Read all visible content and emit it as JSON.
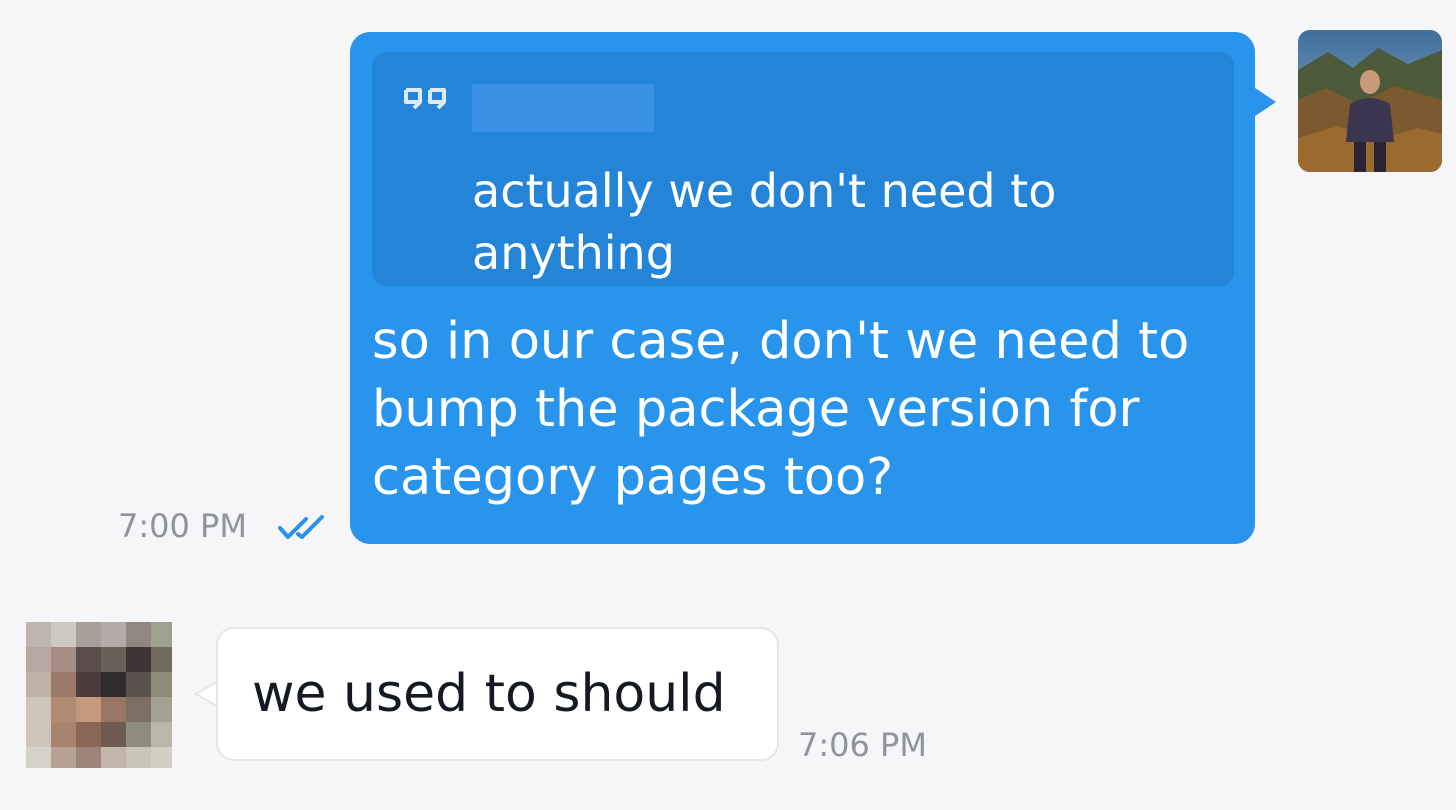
{
  "conversation": {
    "outgoing": {
      "quote": {
        "text": "actually we don't need to\nanything"
      },
      "text": "so in our case, don't we need to\nbump the package version for\ncategory pages too?",
      "time": "7:00 PM",
      "status_icon": "double-check-icon"
    },
    "incoming": {
      "text": "we used to should",
      "time": "7:06 PM"
    }
  },
  "colors": {
    "background": "#f6f6f8",
    "outgoing_bubble": "#2894ec",
    "quote_box": "#2384d8",
    "incoming_bubble": "#ffffff",
    "timestamp": "#8e949c",
    "read_check": "#2894ec"
  }
}
